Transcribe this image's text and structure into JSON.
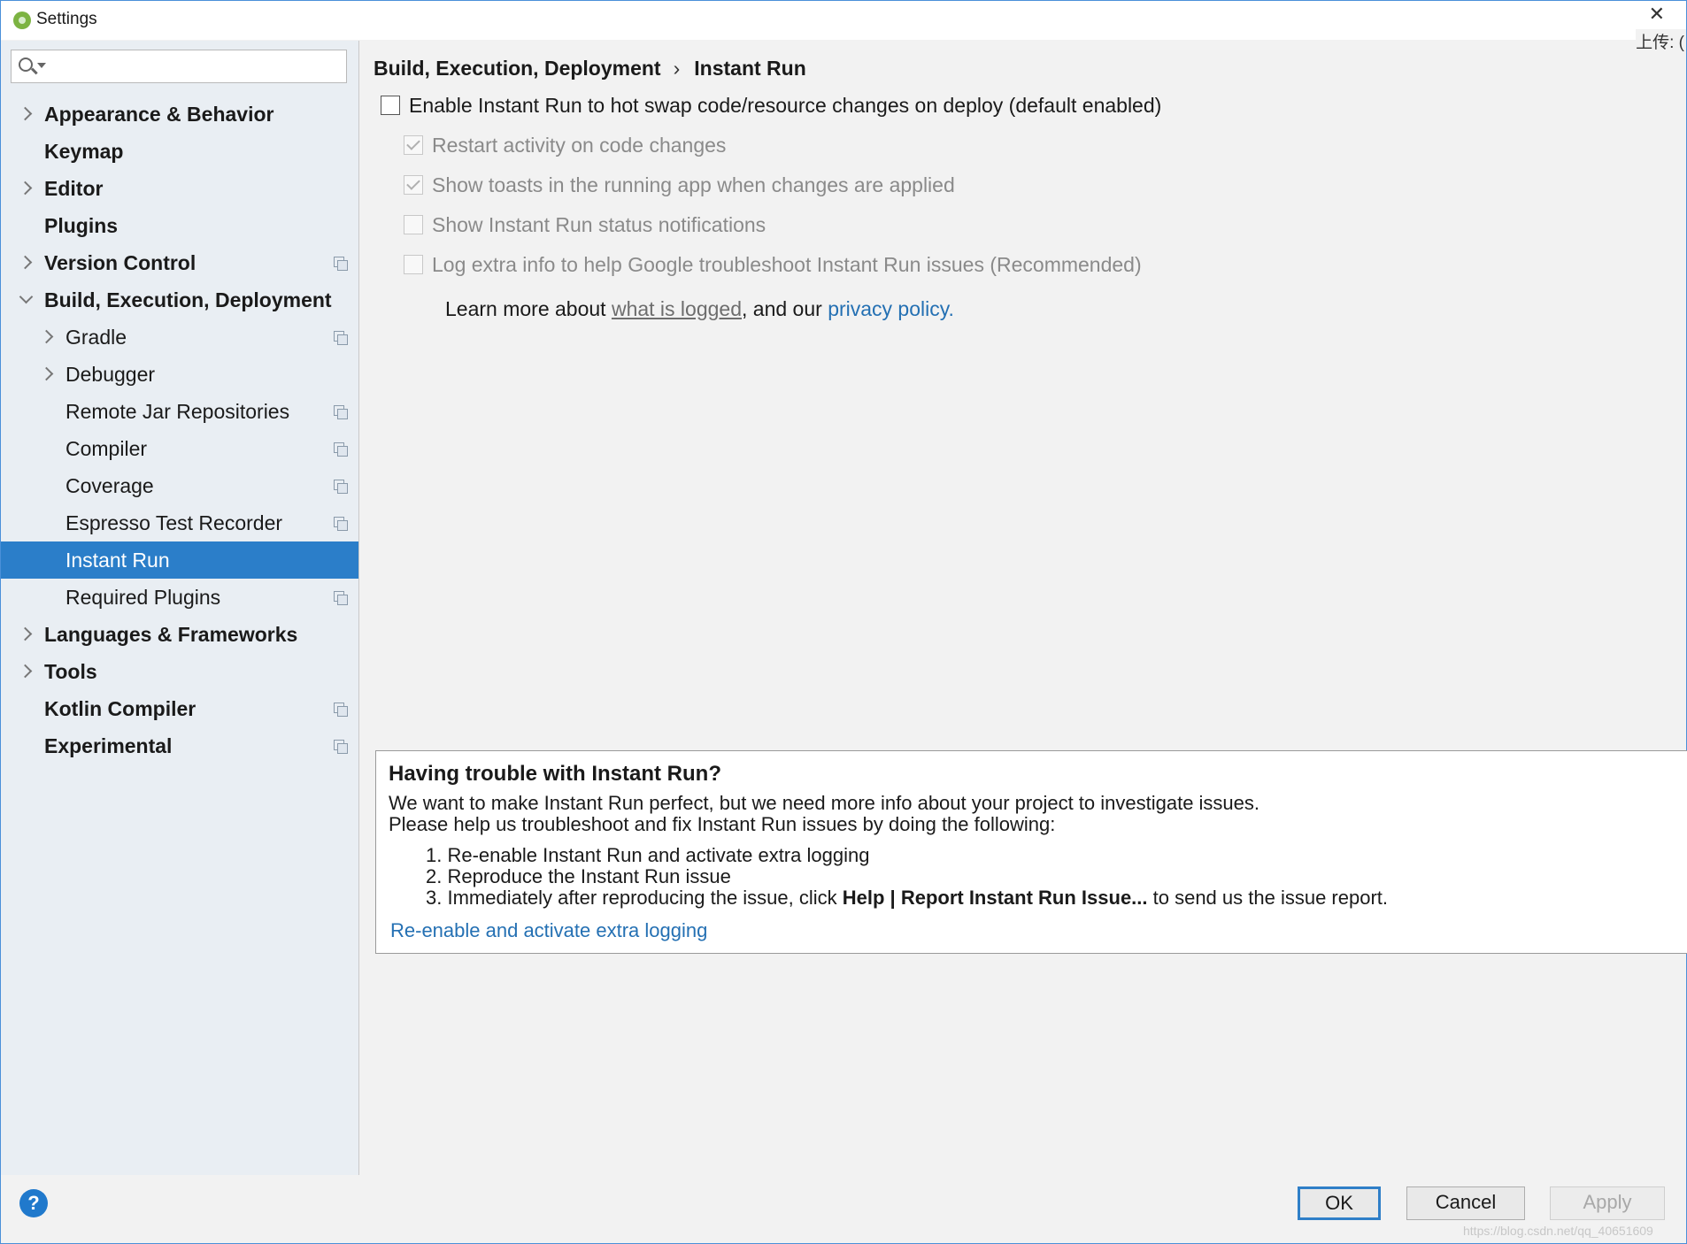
{
  "window": {
    "title": "Settings",
    "overlay_text": "上传: ("
  },
  "search": {
    "placeholder": ""
  },
  "sidebar": {
    "items": [
      {
        "label": "Appearance & Behavior",
        "level": 0,
        "bold": true,
        "expander": "collapsed",
        "project_icon": false,
        "selected": false
      },
      {
        "label": "Keymap",
        "level": 0,
        "bold": true,
        "expander": "none",
        "project_icon": false,
        "selected": false
      },
      {
        "label": "Editor",
        "level": 0,
        "bold": true,
        "expander": "collapsed",
        "project_icon": false,
        "selected": false
      },
      {
        "label": "Plugins",
        "level": 0,
        "bold": true,
        "expander": "none",
        "project_icon": false,
        "selected": false
      },
      {
        "label": "Version Control",
        "level": 0,
        "bold": true,
        "expander": "collapsed",
        "project_icon": true,
        "selected": false
      },
      {
        "label": "Build, Execution, Deployment",
        "level": 0,
        "bold": true,
        "expander": "expanded",
        "project_icon": false,
        "selected": false
      },
      {
        "label": "Gradle",
        "level": 1,
        "bold": false,
        "expander": "collapsed",
        "project_icon": true,
        "selected": false
      },
      {
        "label": "Debugger",
        "level": 1,
        "bold": false,
        "expander": "collapsed",
        "project_icon": false,
        "selected": false
      },
      {
        "label": "Remote Jar Repositories",
        "level": 1,
        "bold": false,
        "expander": "none",
        "project_icon": true,
        "selected": false
      },
      {
        "label": "Compiler",
        "level": 1,
        "bold": false,
        "expander": "none",
        "project_icon": true,
        "selected": false
      },
      {
        "label": "Coverage",
        "level": 1,
        "bold": false,
        "expander": "none",
        "project_icon": true,
        "selected": false
      },
      {
        "label": "Espresso Test Recorder",
        "level": 1,
        "bold": false,
        "expander": "none",
        "project_icon": true,
        "selected": false
      },
      {
        "label": "Instant Run",
        "level": 1,
        "bold": false,
        "expander": "none",
        "project_icon": false,
        "selected": true
      },
      {
        "label": "Required Plugins",
        "level": 1,
        "bold": false,
        "expander": "none",
        "project_icon": true,
        "selected": false
      },
      {
        "label": "Languages & Frameworks",
        "level": 0,
        "bold": true,
        "expander": "collapsed",
        "project_icon": false,
        "selected": false
      },
      {
        "label": "Tools",
        "level": 0,
        "bold": true,
        "expander": "collapsed",
        "project_icon": false,
        "selected": false
      },
      {
        "label": "Kotlin Compiler",
        "level": 0,
        "bold": true,
        "expander": "none",
        "project_icon": true,
        "selected": false
      },
      {
        "label": "Experimental",
        "level": 0,
        "bold": true,
        "expander": "none",
        "project_icon": true,
        "selected": false
      }
    ]
  },
  "breadcrumb": {
    "parent": "Build, Execution, Deployment",
    "separator": "›",
    "current": "Instant Run"
  },
  "options": {
    "enable": {
      "label": "Enable Instant Run to hot swap code/resource changes on deploy (default enabled)",
      "checked": false,
      "enabled": true
    },
    "restart": {
      "label": "Restart activity on code changes",
      "checked": true,
      "enabled": false
    },
    "toasts": {
      "label": "Show toasts in the running app when changes are applied",
      "checked": true,
      "enabled": false
    },
    "status": {
      "label": "Show Instant Run status notifications",
      "checked": false,
      "enabled": false
    },
    "log": {
      "label": "Log extra info to help Google troubleshoot Instant Run issues (Recommended)",
      "checked": false,
      "enabled": false
    }
  },
  "learn_more": {
    "prefix": "Learn more about ",
    "link1": "what is logged",
    "middle": ", and our ",
    "link2": "privacy policy."
  },
  "trouble": {
    "title": "Having trouble with Instant Run?",
    "line1": "We want to make Instant Run perfect, but we need more info about your project to investigate issues.",
    "line2": "Please help us troubleshoot and fix Instant Run issues by doing the following:",
    "step1": "1. Re-enable Instant Run and activate extra logging",
    "step2": "2. Reproduce the Instant Run issue",
    "step3_prefix": "3. Immediately after reproducing the issue, click ",
    "step3_bold": "Help | Report Instant Run Issue...",
    "step3_suffix": " to send us the issue report.",
    "link": "Re-enable and activate extra logging"
  },
  "buttons": {
    "help": "?",
    "ok": "OK",
    "cancel": "Cancel",
    "apply": "Apply"
  },
  "watermark": "https://blog.csdn.net/qq_40651609",
  "colors": {
    "selection": "#2b7ec9",
    "link": "#2470b3",
    "sidebar_bg": "#e9eef3",
    "content_bg": "#f2f2f2"
  }
}
